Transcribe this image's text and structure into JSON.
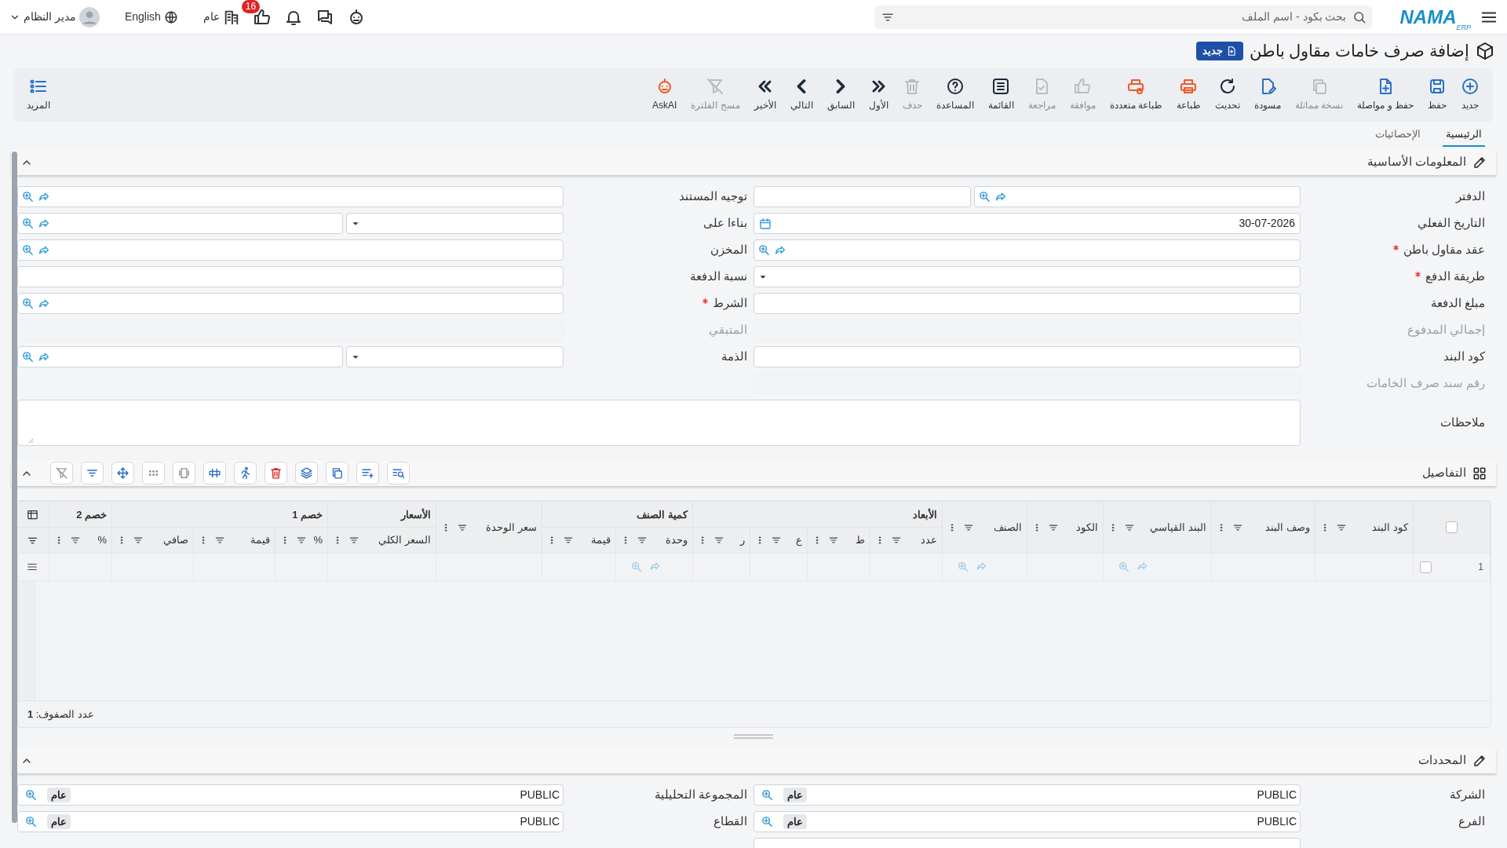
{
  "topbar": {
    "logo": "NAMA",
    "logo_sub": "ERP",
    "search_placeholder": "بحث بكود - اسم الملف",
    "branch": "عام",
    "notifications": "16",
    "language": "English",
    "user": "مدير النظام"
  },
  "title": {
    "text": "إضافة صرف خامات مقاول باطن",
    "badge": "جديد"
  },
  "toolbar": [
    {
      "label": "جديد",
      "disabled": false,
      "color": "#2a6fc9"
    },
    {
      "label": "حفظ",
      "disabled": false,
      "color": "#2a6fc9"
    },
    {
      "label": "حفظ و مواصلة",
      "disabled": false,
      "color": "#2a6fc9"
    },
    {
      "label": "نسخة مماثلة",
      "disabled": true
    },
    {
      "label": "مسودة",
      "disabled": false,
      "color": "#2a6fc9"
    },
    {
      "label": "تحديث",
      "disabled": false,
      "color": "#1f2937"
    },
    {
      "label": "طباعة",
      "disabled": false,
      "color": "#f05a28"
    },
    {
      "label": "طباعة متعددة",
      "disabled": false,
      "color": "#f05a28"
    },
    {
      "label": "موافقة",
      "disabled": true
    },
    {
      "label": "مراجعة",
      "disabled": true
    },
    {
      "label": "القائمة",
      "disabled": false,
      "color": "#1f2937"
    },
    {
      "label": "المساعدة",
      "disabled": false,
      "color": "#1f2937"
    },
    {
      "label": "حذف",
      "disabled": true
    },
    {
      "label": "الأول",
      "disabled": false,
      "color": "#1f2937"
    },
    {
      "label": "السابق",
      "disabled": false,
      "color": "#1f2937"
    },
    {
      "label": "التالي",
      "disabled": false,
      "color": "#1f2937"
    },
    {
      "label": "الأخير",
      "disabled": false,
      "color": "#1f2937"
    },
    {
      "label": "مسح الفلترة",
      "disabled": true
    },
    {
      "label": "AskAI",
      "disabled": false,
      "color": "#f05a28"
    }
  ],
  "more": {
    "label": "المزيد"
  },
  "tabs": [
    {
      "label": "الرئيسية",
      "selected": true
    },
    {
      "label": "الإحصائيات",
      "selected": false
    }
  ],
  "basic_info": {
    "title": "المعلومات الأساسية",
    "expanded": true,
    "rows": [
      [
        {
          "label": "الدفتر",
          "kind": "book",
          "required": false,
          "disabled": false
        },
        {
          "label": "توجيه المستند",
          "kind": "lookup",
          "required": false,
          "disabled": false
        }
      ],
      [
        {
          "label": "التاريخ الفعلي",
          "kind": "date",
          "value": "30-07-2026",
          "required": false,
          "disabled": false
        },
        {
          "label": "بناءا على",
          "kind": "lookup_select",
          "required": false,
          "disabled": false
        }
      ],
      [
        {
          "label": "عقد مقاول باطن",
          "kind": "lookup",
          "required": true,
          "disabled": false
        },
        {
          "label": "المخزن",
          "kind": "lookup",
          "required": false,
          "disabled": false
        }
      ],
      [
        {
          "label": "طريقة الدفع",
          "kind": "select",
          "required": true,
          "disabled": false
        },
        {
          "label": "نسبة الدفعة",
          "kind": "text",
          "required": false,
          "disabled": false
        }
      ],
      [
        {
          "label": "مبلغ الدفعة",
          "kind": "text",
          "required": false,
          "disabled": false
        },
        {
          "label": "الشرط",
          "kind": "lookup",
          "required": true,
          "disabled": false
        }
      ],
      [
        {
          "label": "إجمالي المدفوع",
          "kind": "text",
          "required": false,
          "disabled": true
        },
        {
          "label": "المتبقي",
          "kind": "text",
          "required": false,
          "disabled": true
        }
      ],
      [
        {
          "label": "كود البند",
          "kind": "text",
          "required": false,
          "disabled": false
        },
        {
          "label": "الذمة",
          "kind": "lookup_select",
          "required": false,
          "disabled": false
        }
      ],
      [
        {
          "label": "رقم سند صرف الخامات",
          "kind": "text",
          "required": false,
          "disabled": true
        }
      ]
    ],
    "notes": {
      "label": "ملاحظات"
    }
  },
  "details": {
    "title": "التفاصيل",
    "expanded": true,
    "select_all": {
      "checked": false
    },
    "columns": [
      {
        "label": "كود البند",
        "kind": "plain"
      },
      {
        "label": "وصف البند",
        "kind": "plain"
      },
      {
        "label": "البند القياسي",
        "kind": "lookup"
      },
      {
        "label": "الكود",
        "kind": "plain"
      },
      {
        "label": "الصنف",
        "kind": "lookup"
      },
      {
        "group": "الأبعاد",
        "children": [
          {
            "label": "عدد",
            "kind": "plain"
          },
          {
            "label": "ط",
            "kind": "plain"
          },
          {
            "label": "ع",
            "kind": "plain"
          },
          {
            "label": "ر",
            "kind": "plain"
          }
        ]
      },
      {
        "group": "كمية الصنف",
        "children": [
          {
            "label": "وحدة",
            "kind": "lookup"
          },
          {
            "label": "قيمة",
            "kind": "plain"
          }
        ]
      },
      {
        "label": "سعر الوحدة",
        "kind": "plain"
      },
      {
        "group": "الأسعار",
        "children": [
          {
            "label": "السعر الكلي",
            "kind": "plain"
          }
        ]
      },
      {
        "group": "خصم 1",
        "children": [
          {
            "label": "%",
            "kind": "plain"
          },
          {
            "label": "قيمة",
            "kind": "plain"
          },
          {
            "label": "صافي",
            "kind": "plain"
          }
        ]
      },
      {
        "group": "خصم 2",
        "children": [
          {
            "label": "%",
            "kind": "plain"
          }
        ]
      }
    ],
    "rows": [
      {
        "number": "1",
        "checked": false
      }
    ],
    "row_count": "عدد الصفوف: **1**"
  },
  "dimensions": {
    "title": "المحددات",
    "expanded": true,
    "rows": [
      [
        {
          "label": "الشركة",
          "value": "PUBLIC",
          "chip": "عام"
        },
        {
          "label": "المجموعة التحليلية",
          "value": "PUBLIC",
          "chip": "عام"
        }
      ],
      [
        {
          "label": "الفرع",
          "value": "PUBLIC",
          "chip": "عام"
        },
        {
          "label": "القطاع",
          "value": "PUBLIC",
          "chip": "عام"
        }
      ]
    ]
  }
}
